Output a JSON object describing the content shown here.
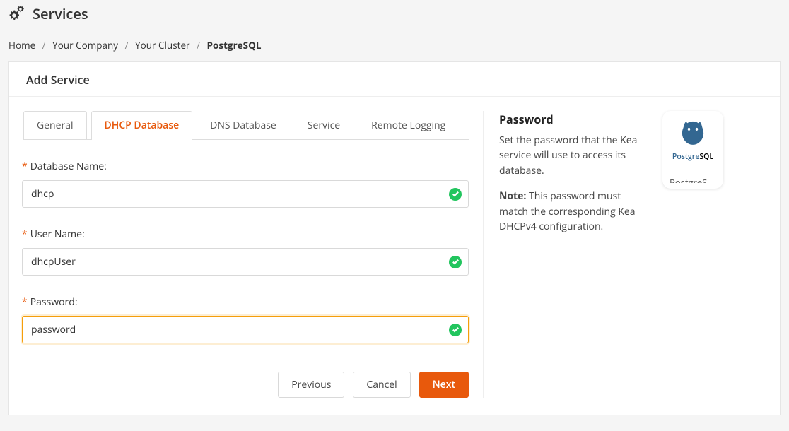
{
  "header": {
    "title": "Services"
  },
  "breadcrumb": {
    "home": "Home",
    "company": "Your Company",
    "cluster": "Your Cluster",
    "current": "PostgreSQL"
  },
  "panel": {
    "title": "Add Service"
  },
  "tabs": {
    "general": "General",
    "dhcp_db": "DHCP Database",
    "dns_db": "DNS Database",
    "service": "Service",
    "remote_logging": "Remote Logging"
  },
  "form": {
    "db_name_label": "Database Name:",
    "db_name_value": "dhcp",
    "user_name_label": "User Name:",
    "user_name_value": "dhcpUser",
    "password_label": "Password:",
    "password_value": "password"
  },
  "buttons": {
    "previous": "Previous",
    "cancel": "Cancel",
    "next": "Next"
  },
  "help": {
    "title": "Password",
    "body": "Set the password that the Kea service will use to access its database.",
    "note_label": "Note:",
    "note_body": "This password must match the corresponding Kea DHCPv4 configuration."
  },
  "logo": {
    "product": "PostgreSQL",
    "brand_left": "Postgre",
    "brand_right": "SQL"
  }
}
